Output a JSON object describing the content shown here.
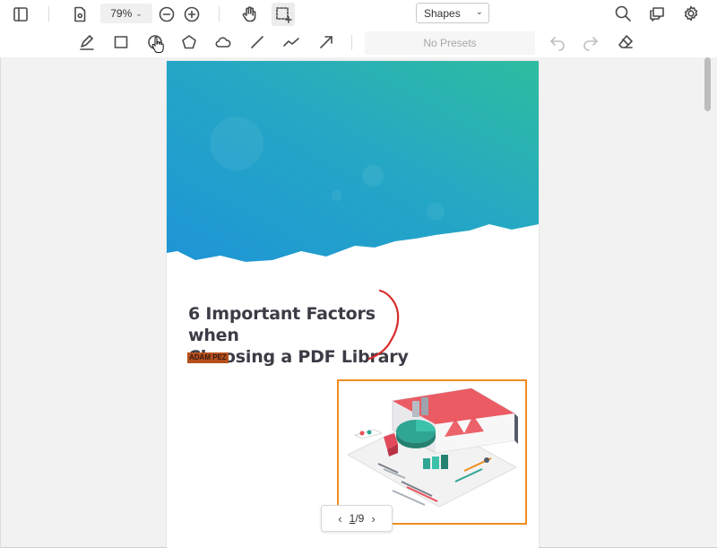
{
  "toolbar": {
    "zoom_value": "79",
    "zoom_unit": "%",
    "tool_mode": "Shapes"
  },
  "annotation_bar": {
    "presets_label": "No Presets"
  },
  "document": {
    "title_line1": "6 Important Factors when",
    "title_line2": "Choosing a PDF Library",
    "author": "ADAM PEZ"
  },
  "pager": {
    "current_page": "1",
    "separator": "/",
    "total_pages": "9"
  },
  "colors": {
    "banner_gradient_start": "#1e95d6",
    "banner_gradient_end": "#2ebd9f",
    "ink_annotation": "#d92b2b",
    "illustration_border": "#ef8c22",
    "author_highlight": "#b5501e"
  }
}
